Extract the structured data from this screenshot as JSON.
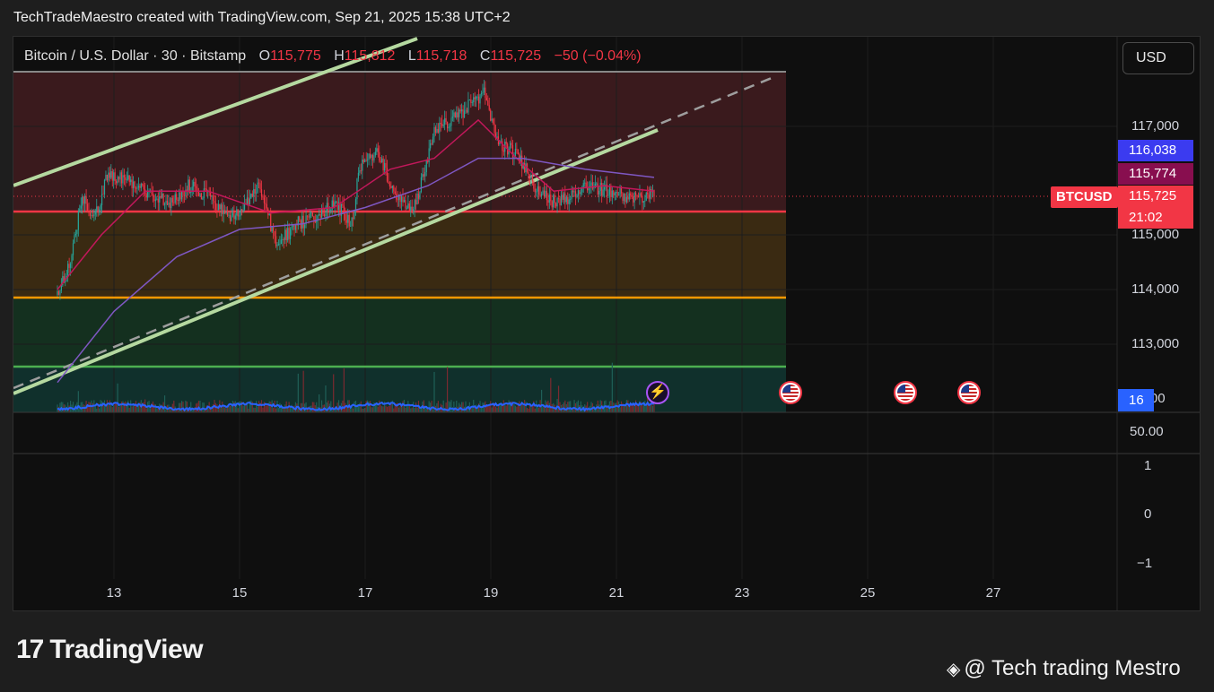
{
  "header": {
    "credit": "TechTradeMaestro created with TradingView.com, Sep 21, 2025 15:38 UTC+2"
  },
  "legend": {
    "symbol": "Bitcoin / U.S. Dollar · 30 · Bitstamp",
    "o_label": "O",
    "o_value": "115,775",
    "h_label": "H",
    "h_value": "115,812",
    "l_label": "L",
    "l_value": "115,718",
    "c_label": "C",
    "c_value": "115,725",
    "change": "−50 (−0.04%)"
  },
  "currency_button": {
    "label": "USD"
  },
  "price_axis": {
    "ticks": [
      "117,000",
      "115,000",
      "114,000",
      "113,000",
      "2,000"
    ],
    "tag_blue": "116,038",
    "tag_purple": "115,774",
    "symbol_tag": "BTCUSD",
    "last_price": "115,725",
    "countdown": "21:02",
    "volume_tag": "16",
    "pane2_top": "50.00",
    "pane2_ticks": [
      "1",
      "0",
      "−1"
    ]
  },
  "time_axis": {
    "ticks": [
      "13",
      "15",
      "17",
      "19",
      "21",
      "23",
      "25",
      "27"
    ]
  },
  "events": [
    {
      "icon": "us-flag-icon"
    },
    {
      "icon": "us-flag-icon"
    },
    {
      "icon": "us-flag-icon"
    }
  ],
  "colors": {
    "up": "#26a69a",
    "down": "#f23645",
    "ma_red": "#c2185b",
    "ma_purple": "#7e57c2",
    "zone_red": "#3a1a1d",
    "zone_orange": "#3a2a12",
    "zone_green": "#14301f",
    "line_red": "#f23645",
    "line_orange": "#ff9800",
    "line_green": "#4caf50",
    "channel": "#a5d6a7"
  },
  "chart_data": {
    "type": "candlestick",
    "symbol": "BTCUSD",
    "interval": "30",
    "x_ticks": [
      "13",
      "15",
      "17",
      "19",
      "21",
      "23",
      "25",
      "27"
    ],
    "y_ticks": [
      113000,
      114000,
      115000,
      117000
    ],
    "ylim": [
      112000,
      118000
    ],
    "horizontal_levels": [
      {
        "price": 115450,
        "color": "red"
      },
      {
        "price": 113850,
        "color": "orange"
      },
      {
        "price": 112600,
        "color": "green"
      }
    ],
    "zones": [
      {
        "from": 115450,
        "to": 117950,
        "color": "red"
      },
      {
        "from": 113850,
        "to": 115450,
        "color": "orange"
      },
      {
        "from": 112600,
        "to": 113850,
        "color": "green"
      }
    ],
    "close_path": [
      [
        12.1,
        113900
      ],
      [
        12.3,
        114500
      ],
      [
        12.5,
        115700
      ],
      [
        12.7,
        115300
      ],
      [
        12.9,
        116100
      ],
      [
        13.2,
        116000
      ],
      [
        13.5,
        115800
      ],
      [
        13.9,
        115600
      ],
      [
        14.2,
        115900
      ],
      [
        14.5,
        115700
      ],
      [
        14.9,
        115300
      ],
      [
        15.3,
        115900
      ],
      [
        15.6,
        114800
      ],
      [
        15.9,
        115200
      ],
      [
        16.2,
        115300
      ],
      [
        16.5,
        115600
      ],
      [
        16.8,
        115200
      ],
      [
        16.9,
        116200
      ],
      [
        17.2,
        116500
      ],
      [
        17.5,
        115700
      ],
      [
        17.8,
        115500
      ],
      [
        18.1,
        116900
      ],
      [
        18.4,
        117100
      ],
      [
        18.7,
        117400
      ],
      [
        18.9,
        117600
      ],
      [
        19.1,
        116700
      ],
      [
        19.4,
        116500
      ],
      [
        19.7,
        115900
      ],
      [
        20.0,
        115600
      ],
      [
        20.3,
        115700
      ],
      [
        20.6,
        115900
      ],
      [
        20.9,
        115800
      ],
      [
        21.2,
        115700
      ],
      [
        21.6,
        115725
      ]
    ],
    "ma_fast_path": [
      [
        12.1,
        114000
      ],
      [
        12.8,
        115000
      ],
      [
        13.5,
        115800
      ],
      [
        14.5,
        115800
      ],
      [
        15.5,
        115400
      ],
      [
        16.5,
        115500
      ],
      [
        17.4,
        116200
      ],
      [
        18.1,
        116400
      ],
      [
        18.8,
        117100
      ],
      [
        19.5,
        116300
      ],
      [
        20.0,
        115800
      ],
      [
        20.8,
        115900
      ],
      [
        21.6,
        115800
      ]
    ],
    "ma_slow_path": [
      [
        12.1,
        112300
      ],
      [
        13.0,
        113600
      ],
      [
        14.0,
        114600
      ],
      [
        15.0,
        115100
      ],
      [
        16.0,
        115200
      ],
      [
        17.0,
        115500
      ],
      [
        18.0,
        115900
      ],
      [
        18.8,
        116400
      ],
      [
        19.5,
        116400
      ],
      [
        20.5,
        116200
      ],
      [
        21.6,
        116050
      ]
    ]
  }
}
